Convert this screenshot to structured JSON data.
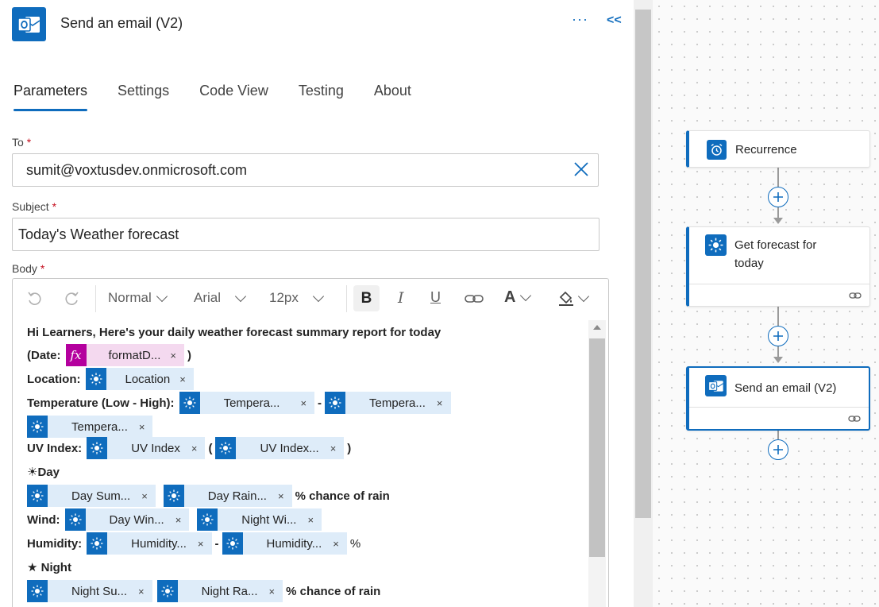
{
  "header": {
    "title": "Send an email (V2)",
    "more": "···",
    "collapse": "<<"
  },
  "tabs": [
    {
      "label": "Parameters",
      "active": true
    },
    {
      "label": "Settings"
    },
    {
      "label": "Code View"
    },
    {
      "label": "Testing"
    },
    {
      "label": "About"
    }
  ],
  "fields": {
    "to": {
      "label": "To",
      "required": "*",
      "value": "sumit@voxtusdev.onmicrosoft.com"
    },
    "subject": {
      "label": "Subject",
      "required": "*",
      "value": "Today's Weather forecast"
    },
    "body": {
      "label": "Body",
      "required": "*"
    }
  },
  "toolbar": {
    "style": "Normal",
    "font": "Arial",
    "size": "12px",
    "bold": "B",
    "italic": "I",
    "underline": "U",
    "font_color": "A"
  },
  "body": {
    "intro": "Hi Learners, Here's your daily weather forecast summary report for today",
    "date_open": "(Date:",
    "date_close": ")",
    "location_label": "Location:",
    "temp_label": "Temperature (Low - High):",
    "uv_label": "UV Index:",
    "uv_open": "(",
    "uv_close": ")",
    "day_heading": "☀Day",
    "chance_of_rain": "% chance of rain",
    "wind_label": "Wind:",
    "humidity_label": "Humidity:",
    "humidity_pct": "%",
    "night_heading": "★ Night",
    "dash": "-",
    "fx_symbol": "fx",
    "remove": "×",
    "tokens": {
      "formatdate": "formatD...",
      "location": "Location",
      "temp1": "Tempera...",
      "temp2": "Tempera...",
      "temp3": "Tempera...",
      "uv1": "UV Index",
      "uv2": "UV Index...",
      "day_summary": "Day Sum...",
      "day_rain": "Day Rain...",
      "day_wind": "Day Win...",
      "night_wind": "Night Wi...",
      "humidity1": "Humidity...",
      "humidity2": "Humidity...",
      "night_summary": "Night Su...",
      "night_rain": "Night Ra..."
    }
  },
  "flow": {
    "cards": [
      {
        "title": "Recurrence",
        "icon": "alarm-clock-icon"
      },
      {
        "title": "Get forecast for today",
        "icon": "sun-icon"
      },
      {
        "title": "Send an email (V2)",
        "icon": "outlook-icon"
      }
    ]
  },
  "colors": {
    "accent": "#0f6cbd",
    "required": "#c50f1f",
    "token_bg": "#deecf9",
    "fx_bg": "#b4009e"
  }
}
